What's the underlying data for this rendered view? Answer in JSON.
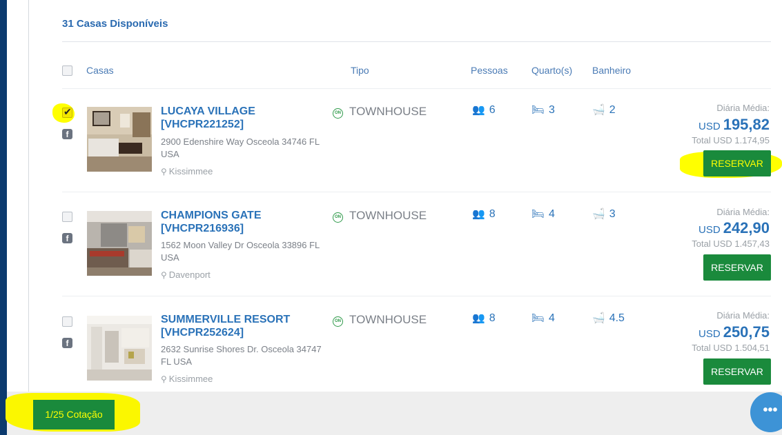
{
  "header": {
    "available": "31 Casas Disponíveis",
    "columns": {
      "houses": "Casas",
      "type": "Tipo",
      "people": "Pessoas",
      "rooms": "Quarto(s)",
      "bathroom": "Banheiro"
    }
  },
  "listings": [
    {
      "checked": true,
      "name": "LUCAYA VILLAGE",
      "code": "[VHCPR221252]",
      "address": "2900 Edenshire Way Osceola 34746 FL USA",
      "city": "Kissimmee",
      "type": "TOWNHOUSE",
      "people": "6",
      "rooms": "3",
      "baths": "2",
      "avg_label": "Diária Média:",
      "currency": "USD",
      "avg_price": "195,82",
      "total": "Total USD 1.174,95",
      "button": "RESERVAR"
    },
    {
      "checked": false,
      "name": "CHAMPIONS GATE",
      "code": "[VHCPR216936]",
      "address": "1562 Moon Valley Dr Osceola 33896 FL USA",
      "city": "Davenport",
      "type": "TOWNHOUSE",
      "people": "8",
      "rooms": "4",
      "baths": "3",
      "avg_label": "Diária Média:",
      "currency": "USD",
      "avg_price": "242,90",
      "total": "Total USD 1.457,43",
      "button": "RESERVAR"
    },
    {
      "checked": false,
      "name": "SUMMERVILLE RESORT",
      "code": "[VHCPR252624]",
      "address": "2632 Sunrise Shores Dr. Osceola 34747 FL USA",
      "city": "Kissimmee",
      "type": "TOWNHOUSE",
      "people": "8",
      "rooms": "4",
      "baths": "4.5",
      "avg_label": "Diária Média:",
      "currency": "USD",
      "avg_price": "250,75",
      "total": "Total USD 1.504,51",
      "button": "RESERVAR"
    }
  ],
  "footer": {
    "quote_button": "1/25 Cotação"
  },
  "colors": {
    "accent_blue": "#2a72b8",
    "button_green": "#1a8a3c",
    "highlight": "#ffff00",
    "background": "#0b3a6e"
  },
  "icons": [
    "check-icon",
    "facebook-icon",
    "townhouse-on-icon",
    "people-icon",
    "bed-icon",
    "bathtub-icon",
    "map-pin-icon",
    "chat-icon"
  ]
}
